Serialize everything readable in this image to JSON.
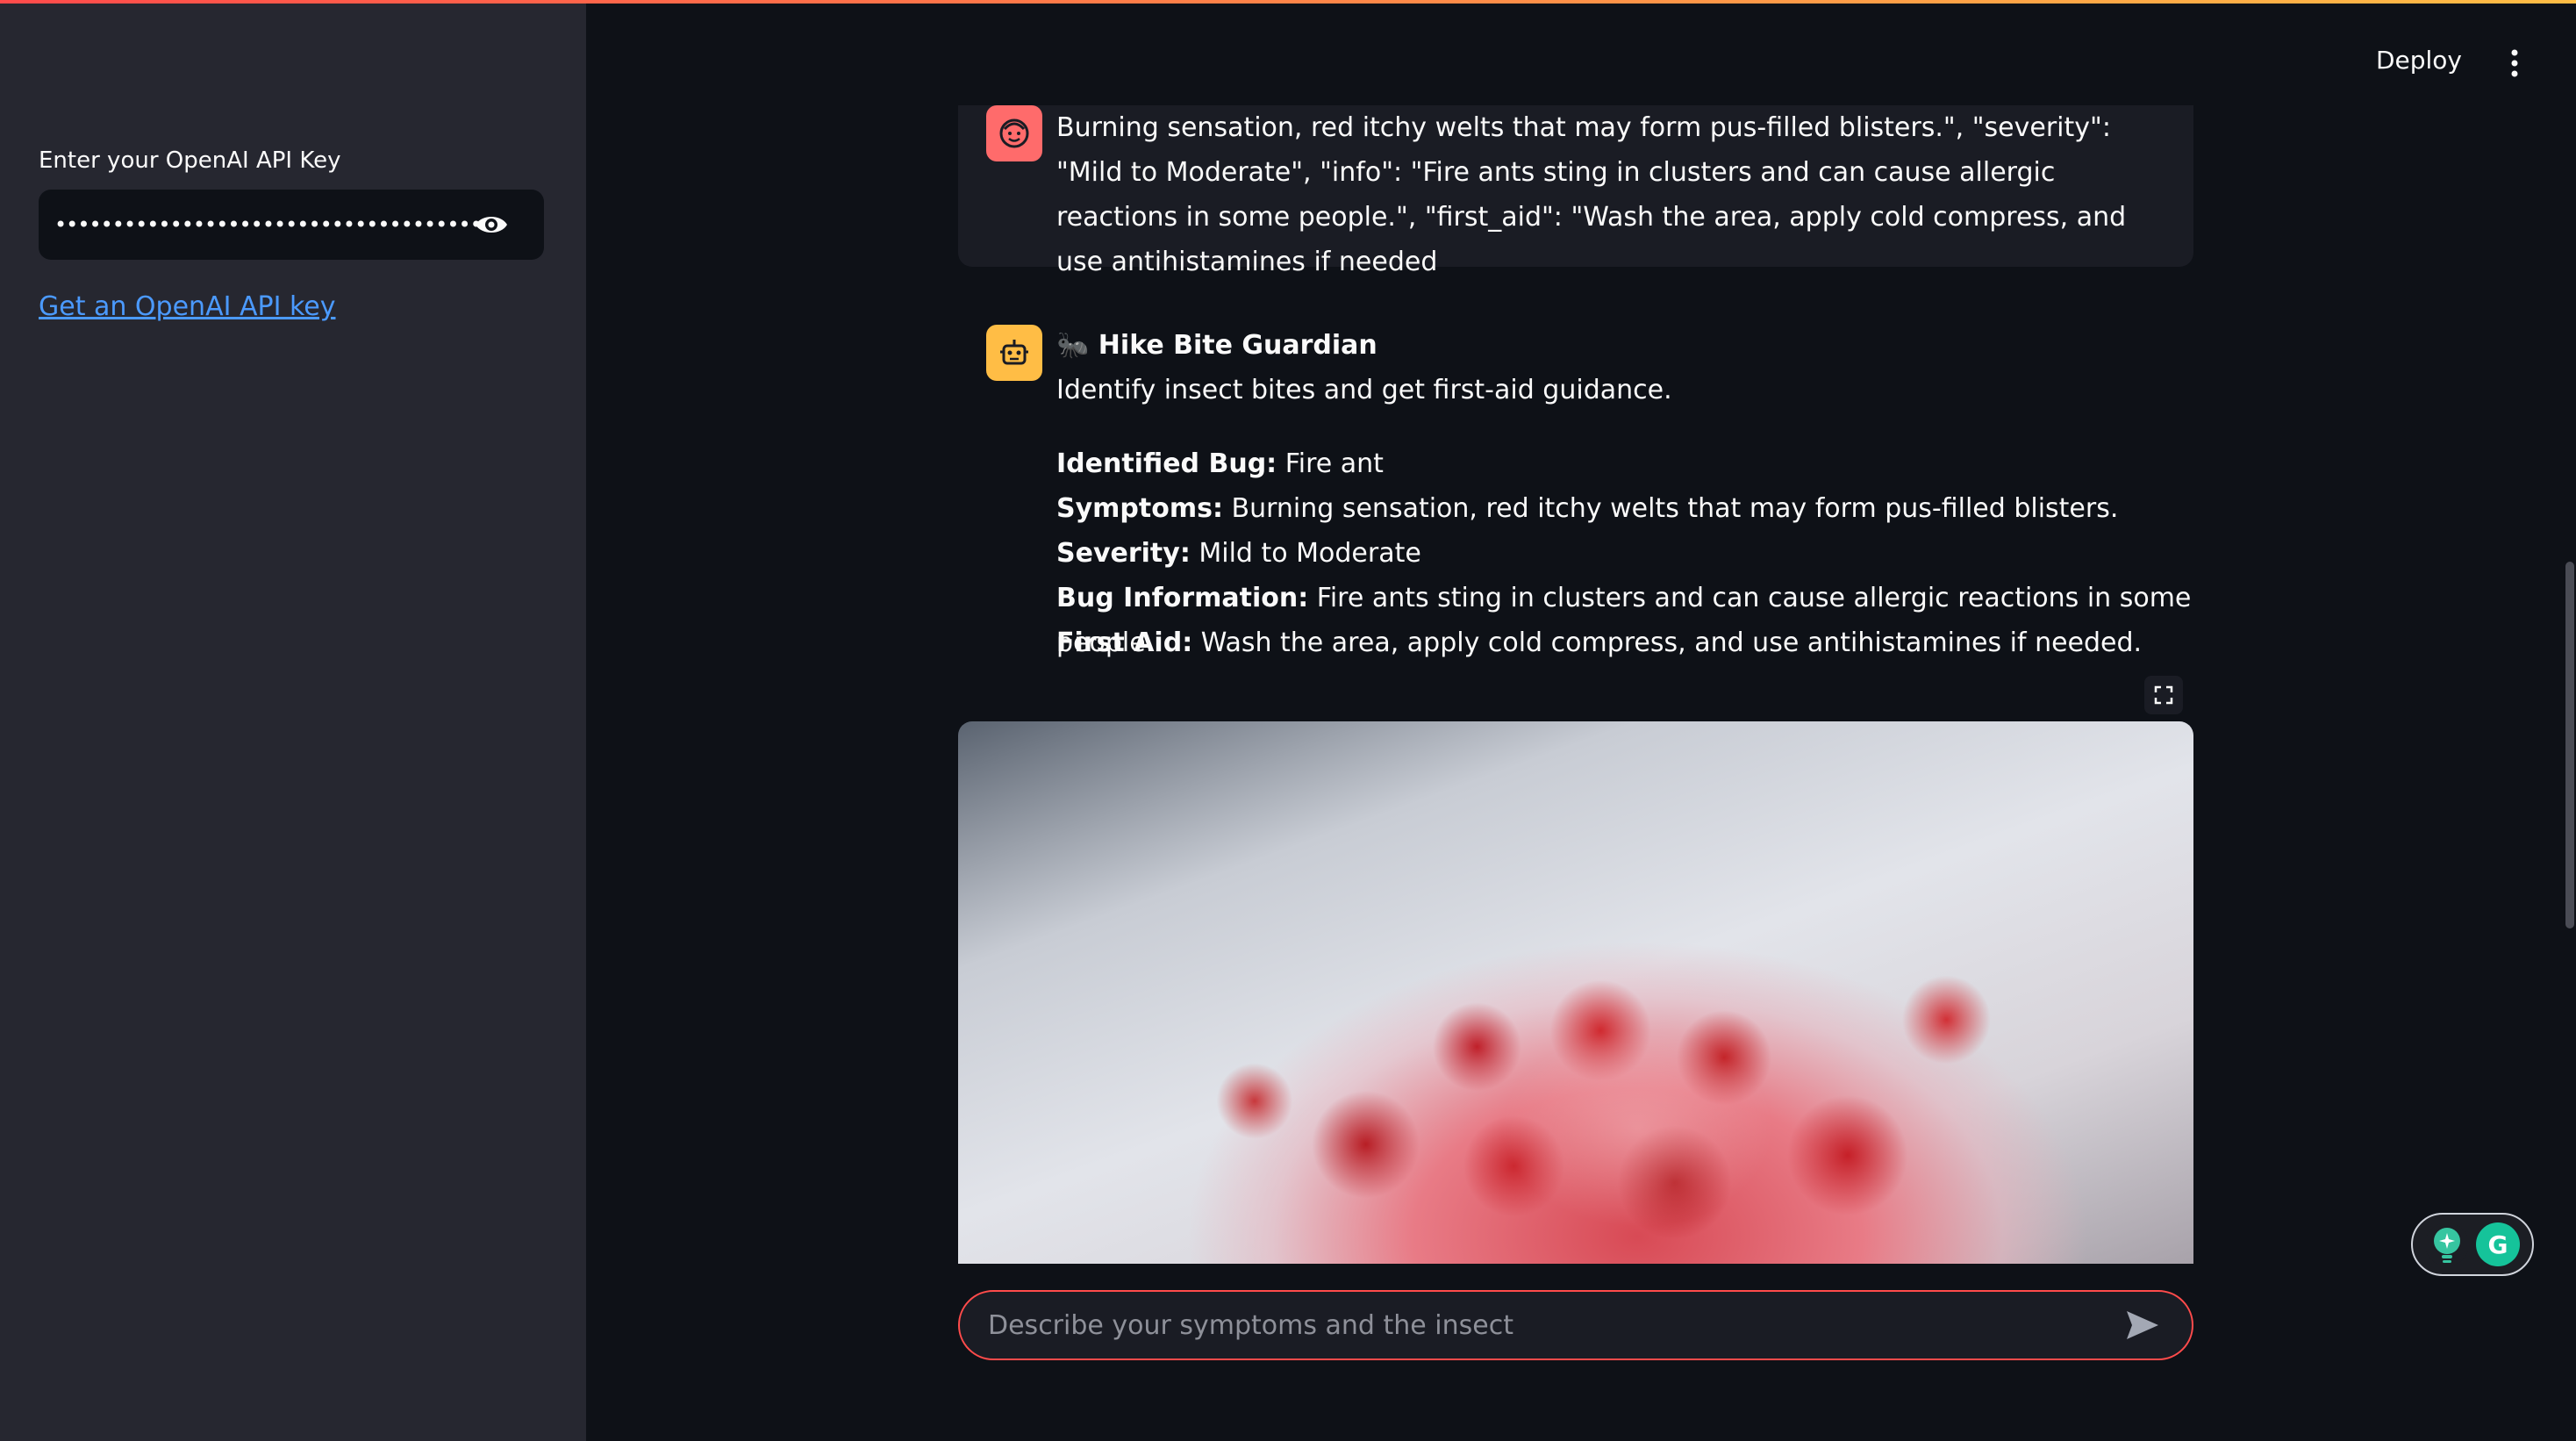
{
  "sidebar": {
    "api_key_label": "Enter your OpenAI API Key",
    "api_key_value": "••••••••••••••••••••••••••••••••••••••••••••••••••••",
    "api_key_link": "Get an OpenAI API key"
  },
  "header": {
    "deploy_label": "Deploy"
  },
  "chat": {
    "user_message": "Burning sensation, red itchy welts that may form pus-filled blisters.\", \"severity\": \"Mild to Moderate\", \"info\": \"Fire ants sting in clusters and can cause allergic reactions in some people.\", \"first_aid\": \"Wash the area, apply cold compress, and use antihistamines if needed",
    "bot_title": "🐜 Hike Bite Guardian",
    "bot_intro": "Identify insect bites and get first-aid guidance.",
    "fields": [
      {
        "label": "Identified Bug:",
        "value": " Fire ant"
      },
      {
        "label": "Symptoms:",
        "value": " Burning sensation, red itchy welts that may form pus-filled blisters."
      },
      {
        "label": "Severity:",
        "value": " Mild to Moderate"
      },
      {
        "label": "Bug Information:",
        "value": " Fire ants sting in clusters and can cause allergic reactions in some people."
      },
      {
        "label": "First Aid:",
        "value": " Wash the area, apply cold compress, and use antihistamines if needed."
      }
    ]
  },
  "chat_input": {
    "placeholder": "Describe your symptoms and the insect"
  },
  "grammarly": {
    "letter": "G"
  },
  "colors": {
    "accent": "#ff4b4b",
    "link": "#4b9aff",
    "user_avatar": "#ff6b6b",
    "bot_avatar": "#ffbd45",
    "sidebar_bg": "#262730",
    "main_bg": "#0e1117"
  },
  "icons": {
    "user_avatar": "face-icon",
    "bot_avatar": "robot-icon",
    "reveal": "eye-icon",
    "menu": "more-vertical-icon",
    "fullscreen": "fullscreen-icon",
    "send": "send-icon"
  }
}
